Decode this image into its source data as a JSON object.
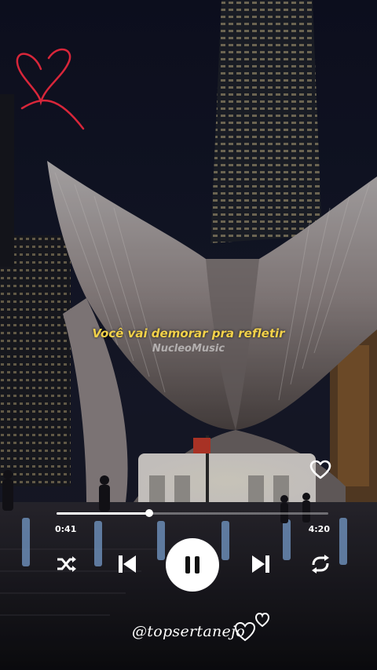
{
  "lyric": {
    "line": "Você vai demorar pra refletir",
    "watermark": "NucleoMusic"
  },
  "player": {
    "elapsed": "0:41",
    "duration": "4:20",
    "progress": 0.34,
    "state": "playing",
    "liked": false
  },
  "credit": {
    "handle": "@topsertanejo"
  },
  "icons": {
    "decor": "hand-drawn-heart-icon",
    "like": "heart-outline-icon",
    "shuffle": "shuffle-icon",
    "prev": "skip-previous-icon",
    "play_pause": "pause-icon",
    "next": "skip-next-icon",
    "repeat": "repeat-icon",
    "handle_decor": "double-heart-outline-icon"
  },
  "colors": {
    "lyric": "#f3d24a",
    "decor_heart": "#d8263a",
    "controls": "#ffffff"
  }
}
